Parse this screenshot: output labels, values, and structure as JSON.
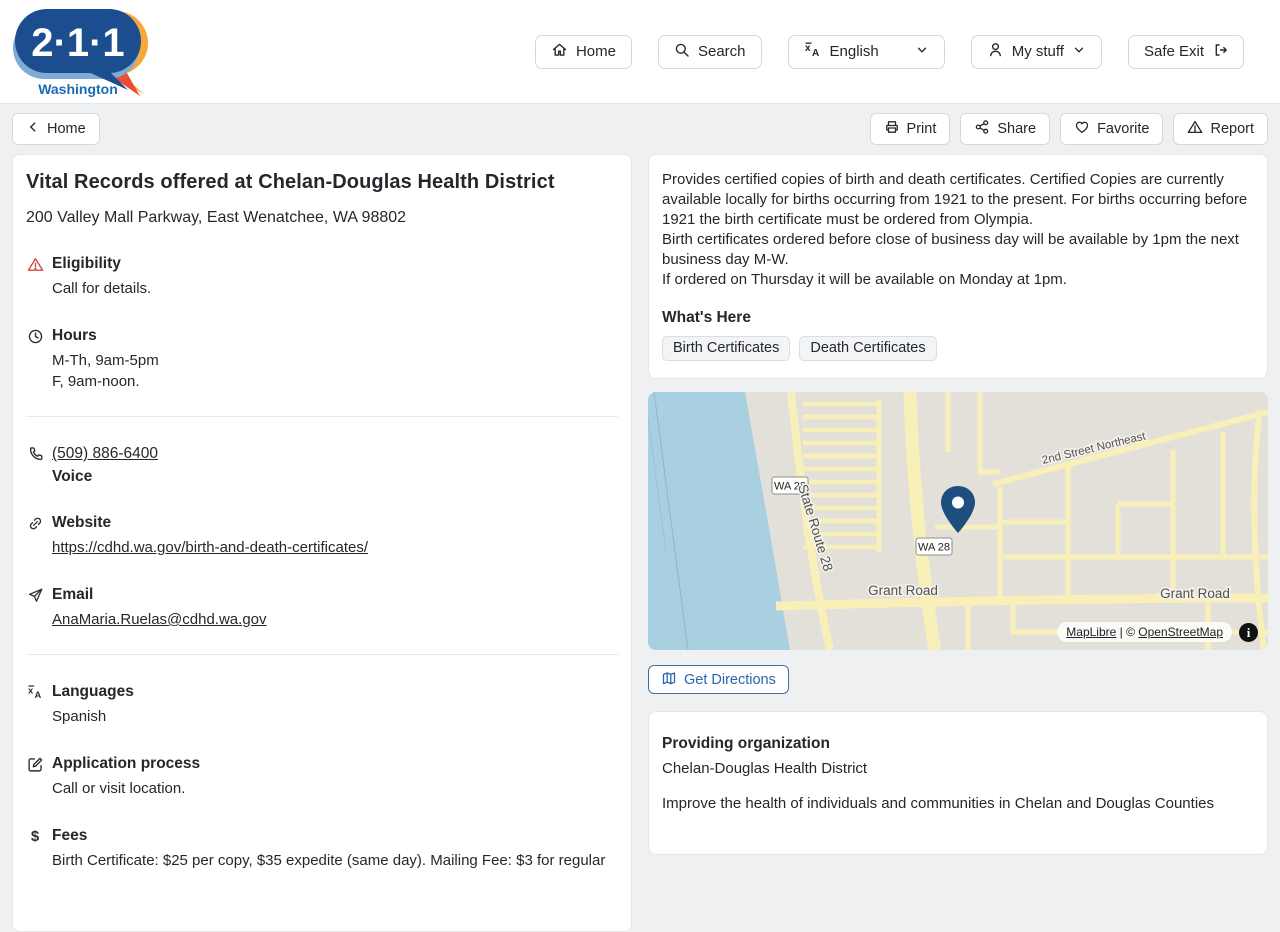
{
  "brand": {
    "number": "2·1·1",
    "region": "Washington"
  },
  "nav": {
    "home": "Home",
    "search": "Search",
    "language": "English",
    "my_stuff": "My stuff",
    "safe_exit": "Safe Exit"
  },
  "toolbar": {
    "back": "Home",
    "print": "Print",
    "share": "Share",
    "favorite": "Favorite",
    "report": "Report"
  },
  "service": {
    "title": "Vital Records offered at Chelan-Douglas Health District",
    "address": "200 Valley Mall Parkway, East Wenatchee, WA 98802",
    "eligibility": {
      "label": "Eligibility",
      "value": "Call for details."
    },
    "hours": {
      "label": "Hours",
      "line1": "M-Th, 9am-5pm",
      "line2": "F, 9am-noon."
    },
    "phone": {
      "number": "(509) 886-6400",
      "type": "Voice"
    },
    "website": {
      "label": "Website",
      "url": "https://cdhd.wa.gov/birth-and-death-certificates/"
    },
    "email": {
      "label": "Email",
      "address": "AnaMaria.Ruelas@cdhd.wa.gov"
    },
    "languages": {
      "label": "Languages",
      "value": "Spanish"
    },
    "application": {
      "label": "Application process",
      "value": "Call or visit location."
    },
    "fees": {
      "label": "Fees",
      "value": "Birth Certificate: $25 per copy, $35 expedite (same day). Mailing Fee: $3 for regular"
    }
  },
  "details": {
    "p1": "Provides certified copies of birth and death certificates. Certified Copies are currently available locally for births occurring from 1921 to the present. For births occurring before 1921 the birth certificate must be ordered from Olympia.",
    "p2": "Birth certificates ordered before close of business day will be available by 1pm the next business day M-W.",
    "p3": "If ordered on Thursday it will be available on Monday at 1pm.",
    "whats_here_label": "What's Here",
    "tags": [
      "Birth Certificates",
      "Death Certificates"
    ]
  },
  "map": {
    "shield": "WA 28",
    "route_label": "State Route 28",
    "street_ne": "2nd Street Northeast",
    "grant_road": "Grant Road",
    "attribution": {
      "maplibre": "MapLibre",
      "sep": " | © ",
      "osm": "OpenStreetMap",
      "info": "i"
    },
    "colors": {
      "water": "#a9d0e1",
      "land": "#e3e0da",
      "road": "#f8efb9",
      "pin": "#1d4e7f"
    }
  },
  "directions": {
    "label": "Get Directions"
  },
  "provider": {
    "heading": "Providing organization",
    "name": "Chelan-Douglas Health District",
    "description": "Improve the health of individuals and communities in Chelan and Douglas Counties"
  }
}
